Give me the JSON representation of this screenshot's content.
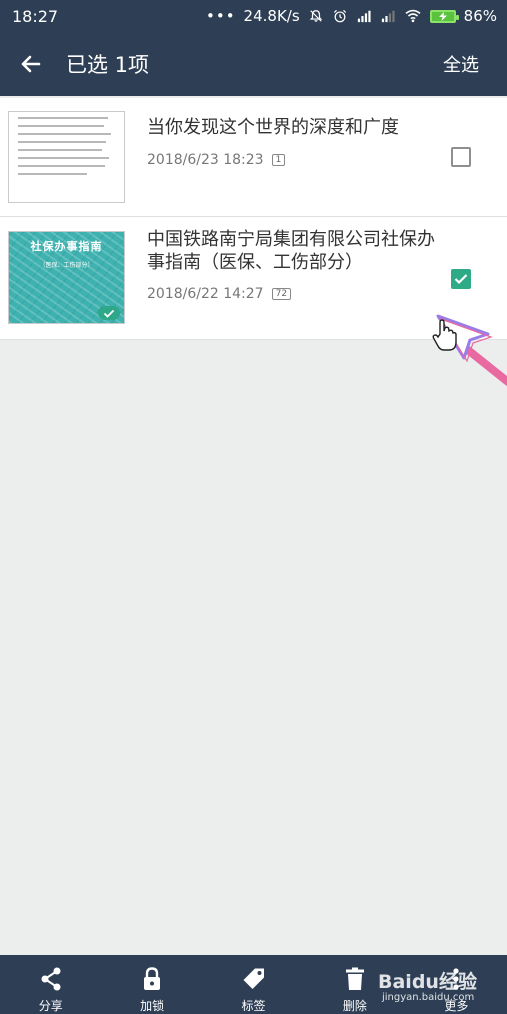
{
  "status_bar": {
    "time": "18:27",
    "dots": "•••",
    "speed": "24.8K/s",
    "battery": "86%"
  },
  "app_bar": {
    "title": "已选 1项",
    "select_all": "全选"
  },
  "documents": [
    {
      "title": "当你发现这个世界的深度和广度",
      "date": "2018/6/23 18:23",
      "pages": "1",
      "checked": false
    },
    {
      "title": "中国铁路南宁局集团有限公司社保办事指南（医保、工伤部分）",
      "date": "2018/6/22 14:27",
      "pages": "72",
      "checked": true,
      "cover_title": "社保办事指南",
      "cover_subtitle": "（医保、工伤部分）"
    }
  ],
  "bottom_bar": {
    "items": [
      {
        "label": "分享",
        "icon": "share-icon"
      },
      {
        "label": "加锁",
        "icon": "lock-icon"
      },
      {
        "label": "标签",
        "icon": "tag-icon"
      },
      {
        "label": "删除",
        "icon": "trash-icon"
      },
      {
        "label": "更多",
        "icon": "more-icon"
      }
    ]
  },
  "watermark": {
    "brand": "Baidu经验",
    "url": "jingyan.baidu.com"
  },
  "colors": {
    "bar": "#2e3f55",
    "accent": "#2eaa87",
    "background": "#eceeed"
  }
}
